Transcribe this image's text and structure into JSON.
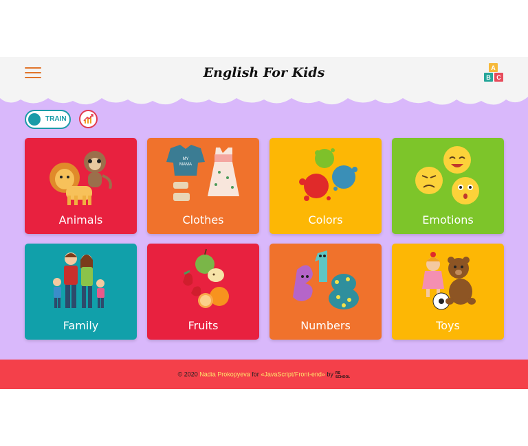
{
  "header": {
    "title": "English For Kids",
    "logo_letters": [
      "A",
      "B",
      "C"
    ]
  },
  "controls": {
    "mode_label": "TRAIN"
  },
  "categories": [
    {
      "label": "Animals",
      "color": "#e8213f"
    },
    {
      "label": "Clothes",
      "color": "#f0722c"
    },
    {
      "label": "Colors",
      "color": "#fdb705"
    },
    {
      "label": "Emotions",
      "color": "#7dc52a"
    },
    {
      "label": "Family",
      "color": "#11a0aa"
    },
    {
      "label": "Fruits",
      "color": "#e8213f"
    },
    {
      "label": "Numbers",
      "color": "#f0722c"
    },
    {
      "label": "Toys",
      "color": "#fdb705"
    }
  ],
  "footer": {
    "prefix": "© 2020",
    "author": "Nadia Prokopyeva",
    "for_text": "for",
    "course": "«JavaScript/Front-end»",
    "by_text": "by",
    "school_logo": "RS SCHOOL"
  },
  "colors": {
    "background": "#d9b8fb",
    "header": "#f4f4f4",
    "footer": "#f4404a",
    "accent": "#1a9ba8"
  }
}
